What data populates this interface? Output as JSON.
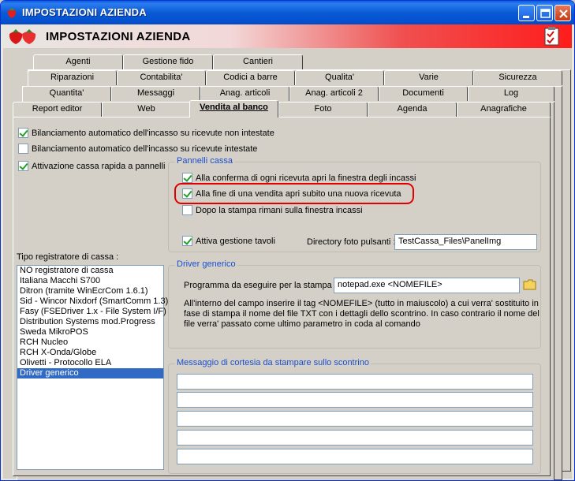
{
  "window": {
    "title": "IMPOSTAZIONI AZIENDA",
    "header_title": "IMPOSTAZIONI AZIENDA"
  },
  "tabs": {
    "row1": [
      "Agenti",
      "Gestione fido",
      "Cantieri"
    ],
    "row2": [
      "Riparazioni",
      "Contabilita'",
      "Codici a barre",
      "Qualita'",
      "Varie",
      "Sicurezza"
    ],
    "row3": [
      "Quantita'",
      "Messaggi",
      "Anag. articoli",
      "Anag. articoli 2",
      "Documenti",
      "Log"
    ],
    "row4": [
      "Report editor",
      "Web",
      "Vendita al banco",
      "Foto",
      "Agenda",
      "Anagrafiche"
    ],
    "active": "Vendita al banco"
  },
  "options": {
    "bil_non_intestate": {
      "label": "Bilanciamento automatico dell'incasso su ricevute non intestate",
      "checked": true
    },
    "bil_intestate": {
      "label": "Bilanciamento automatico dell'incasso su ricevute intestate",
      "checked": false
    },
    "cassa_rapida": {
      "label": "Attivazione cassa rapida a pannelli",
      "checked": true
    }
  },
  "pannelli": {
    "title": "Pannelli cassa",
    "apri_incassi": {
      "label": "Alla conferma di ogni ricevuta apri la finestra degli incassi",
      "checked": true
    },
    "nuova_ricevuta": {
      "label": "Alla fine di una vendita apri subito una nuova ricevuta",
      "checked": true
    },
    "rimani_incassi": {
      "label": "Dopo la stampa rimani sulla finestra incassi",
      "checked": false
    },
    "tavoli": {
      "label": "Attiva gestione tavoli",
      "checked": true
    },
    "directory_label": "Directory foto pulsanti :",
    "directory_value": "TestCassa_Files\\PanelImg"
  },
  "registratore": {
    "label": "Tipo registratore di cassa :",
    "items": [
      "NO registratore di cassa",
      "Italiana Macchi S700",
      "Ditron (tramite WinEcrCom 1.6.1)",
      "Sid - Wincor Nixdorf (SmartComm 1.3)",
      "Fasy (FSEDriver 1.x - File System I/F)",
      "Distribution Systems mod.Progress",
      "Sweda MikroPOS",
      "RCH Nucleo",
      "RCH X-Onda/Globe",
      "Olivetti - Protocollo ELA",
      "Driver generico"
    ],
    "selected": "Driver generico"
  },
  "driver": {
    "title": "Driver generico",
    "program_label": "Programma da eseguire per la stampa :",
    "program_value": "notepad.exe <NOMEFILE>",
    "desc1": "All'interno del campo inserire il tag <NOMEFILE> (tutto in maiuscolo) a cui verra' sostituito in",
    "desc2": "fase di stampa il nome del file TXT con i dettagli dello scontrino. In caso contrario il nome del",
    "desc3": "file verra' passato come ultimo parametro in coda al comando"
  },
  "messaggio": {
    "title": "Messaggio di cortesia da stampare sullo scontrino",
    "lines": [
      "",
      "",
      "",
      "",
      ""
    ]
  },
  "colors": {
    "title_bar": "#0a5ad4",
    "group_title": "#1a4fcc",
    "selection": "#316ac5",
    "highlight_ring": "#e00000"
  },
  "icons": [
    "strawberry-icon",
    "minimize-icon",
    "maximize-icon",
    "close-icon",
    "checklist-icon",
    "folder-icon"
  ]
}
